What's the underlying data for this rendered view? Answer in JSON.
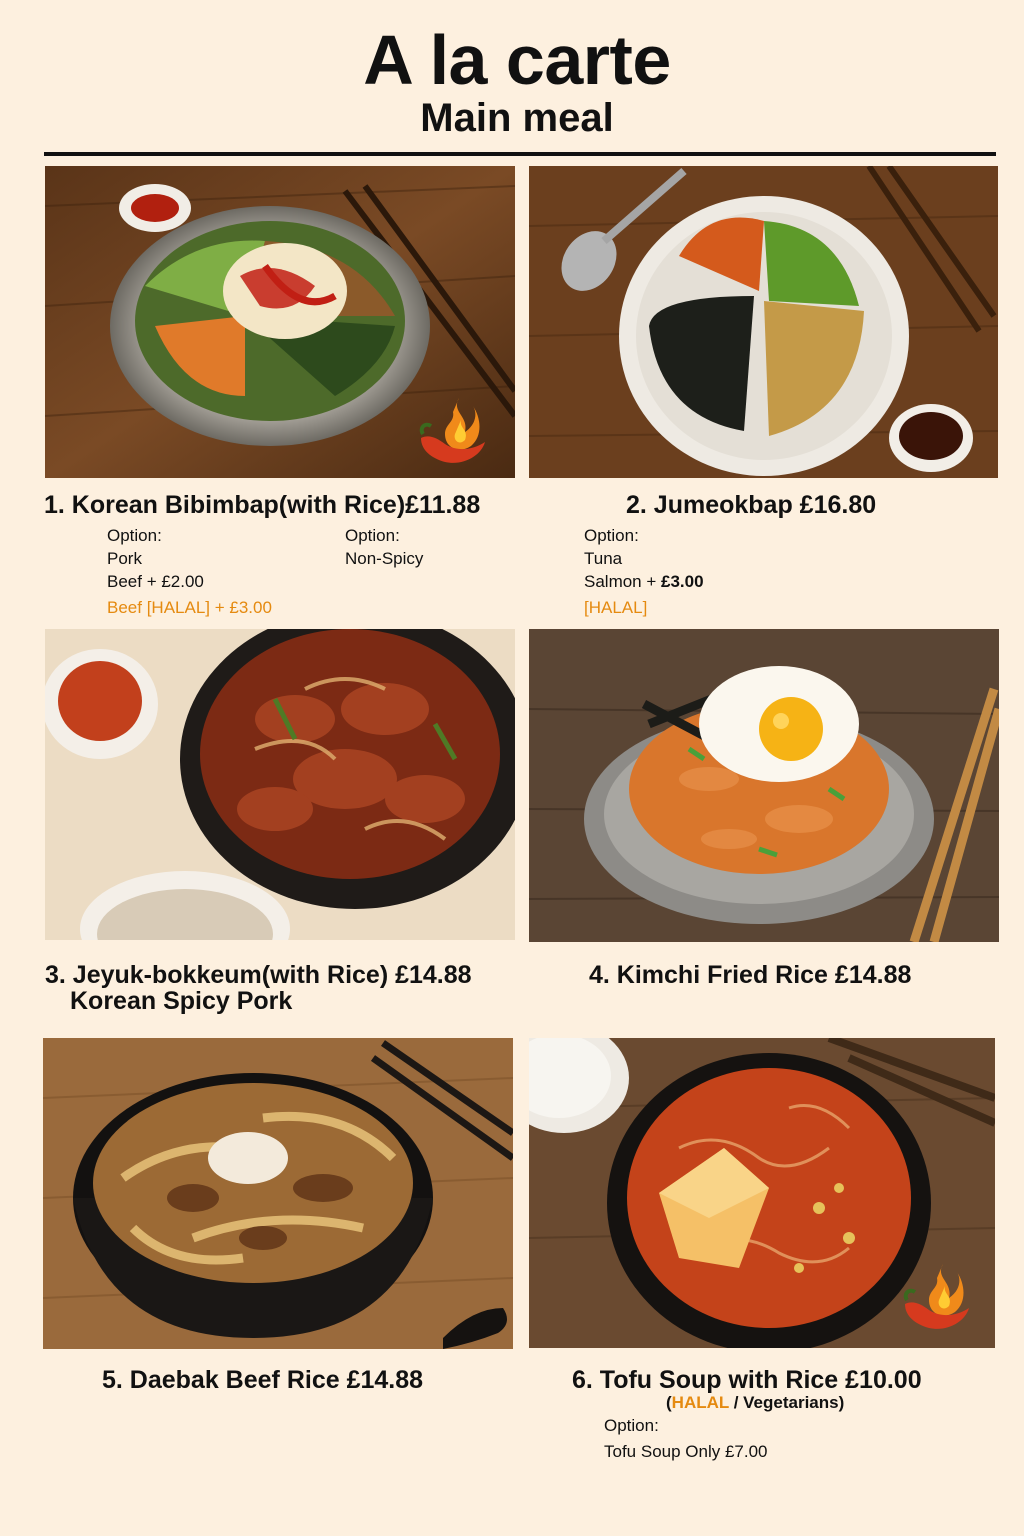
{
  "header": {
    "title": "A la carte",
    "subtitle": "Main meal"
  },
  "colors": {
    "background": "#fdf0df",
    "halal_accent": "#e58a10",
    "rule": "#111111"
  },
  "items": [
    {
      "title": "1. Korean Bibimbap(with Rice)£11.88",
      "spicy": true,
      "option_col1": {
        "label": "Option:",
        "lines": [
          "Pork",
          "Beef + £2.00"
        ],
        "halal_line": "Beef [HALAL] + £3.00"
      },
      "option_col2": {
        "label": "Option:",
        "lines": [
          "Non-Spicy"
        ]
      }
    },
    {
      "title": "2. Jumeokbap  £16.80",
      "spicy": false,
      "options": {
        "label": "Option:",
        "line1": "Tuna",
        "line2_prefix": "Salmon + ",
        "line2_price": "£3.00",
        "halal_line": "[HALAL]"
      }
    },
    {
      "title_line1": "3. Jeyuk-bokkeum(with Rice) £14.88",
      "title_line2": "Korean Spicy Pork",
      "spicy": false
    },
    {
      "title": "4. Kimchi Fried Rice  £14.88",
      "spicy": false
    },
    {
      "title": "5. Daebak Beef Rice  £14.88",
      "spicy": false
    },
    {
      "title": "6. Tofu Soup with Rice  £10.00",
      "spicy": true,
      "note": {
        "open": "(",
        "halal": "HALAL",
        "rest": " / Vegetarians)"
      },
      "options": {
        "label": "Option:",
        "line1": "Tofu Soup Only  £7.00"
      }
    }
  ],
  "icons": [
    "chili-flame-icon"
  ]
}
